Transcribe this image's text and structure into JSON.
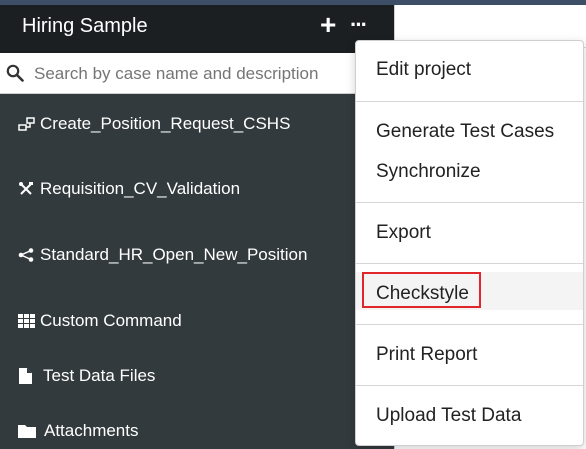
{
  "header": {
    "title": "Hiring Sample",
    "add_icon": "plus-icon",
    "more_icon": "ellipsis-icon"
  },
  "search": {
    "placeholder": "Search by case name and description",
    "value": ""
  },
  "sidebar": {
    "items": [
      {
        "label": "Create_Position_Request_CSHS",
        "icon": "flow-icon"
      },
      {
        "label": "Requisition_CV_Validation",
        "icon": "tools-icon"
      },
      {
        "label": "Standard_HR_Open_New_Position",
        "icon": "share-nodes-icon"
      },
      {
        "label": "Custom Command",
        "icon": "grid-icon"
      },
      {
        "label": "Test Data Files",
        "icon": "file-icon"
      },
      {
        "label": "Attachments",
        "icon": "folder-icon"
      }
    ]
  },
  "menu": {
    "items": [
      {
        "label": "Edit project"
      },
      {
        "label": "Generate Test Cases"
      },
      {
        "label": "Synchronize"
      },
      {
        "label": "Export"
      },
      {
        "label": "Checkstyle",
        "highlighted": true
      },
      {
        "label": "Print Report"
      },
      {
        "label": "Upload Test Data"
      }
    ]
  },
  "colors": {
    "header_bg": "#1b1f22",
    "sidebar_bg": "#333a3d",
    "highlight_border": "#e0252b",
    "top_strip": "#3d4f66"
  }
}
